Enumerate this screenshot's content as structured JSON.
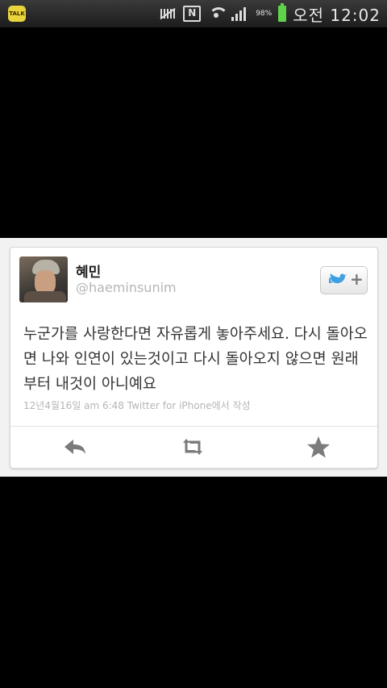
{
  "status_bar": {
    "app_badge": "TALK",
    "battery": "98%",
    "time": "오전 12:02",
    "icons": [
      "kakaotalk-icon",
      "mute-icon",
      "nfc-icon",
      "wifi-icon",
      "signal-icon",
      "battery-icon"
    ]
  },
  "tweet": {
    "name": "혜민",
    "handle": "@haeminsunim",
    "text": "누군가를 사랑한다면 자유롭게 놓아주세요. 다시 돌아오면 나와 인연이 있는것이고 다시 돌아오지 않으면 원래부터 내것이 아니예요",
    "meta": "12년4월16일 am 6:48  Twitter for iPhone에서 작성",
    "follow_plus": "+"
  },
  "colors": {
    "twitter_blue": "#3f9fe0",
    "battery_green": "#5fd34a",
    "action_gray": "#7b7b7b"
  }
}
